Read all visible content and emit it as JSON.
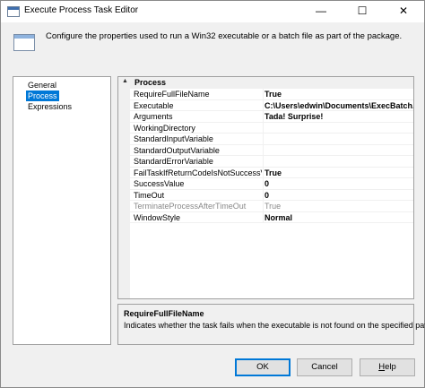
{
  "window": {
    "title": "Execute Process Task Editor",
    "minimize_glyph": "—",
    "maximize_glyph": "☐",
    "close_glyph": "✕"
  },
  "header": {
    "text": "Configure the properties used to run a Win32 executable or a batch file as part of the package."
  },
  "nav": {
    "items": [
      {
        "label": "General",
        "selected": false
      },
      {
        "label": "Process",
        "selected": true
      },
      {
        "label": "Expressions",
        "selected": false
      }
    ]
  },
  "grid": {
    "category": "Process",
    "toggle_glyph": "▲",
    "rows": [
      {
        "name": "RequireFullFileName",
        "value": "True"
      },
      {
        "name": "Executable",
        "value": "C:\\Users\\edwin\\Documents\\ExecBatch.bat"
      },
      {
        "name": "Arguments",
        "value": "Tada! Surprise!"
      },
      {
        "name": "WorkingDirectory",
        "value": ""
      },
      {
        "name": "StandardInputVariable",
        "value": ""
      },
      {
        "name": "StandardOutputVariable",
        "value": ""
      },
      {
        "name": "StandardErrorVariable",
        "value": ""
      },
      {
        "name": "FailTaskIfReturnCodeIsNotSuccessValue",
        "value": "True"
      },
      {
        "name": "SuccessValue",
        "value": "0"
      },
      {
        "name": "TimeOut",
        "value": "0"
      },
      {
        "name": "TerminateProcessAfterTimeOut",
        "value": "True"
      },
      {
        "name": "WindowStyle",
        "value": "Normal"
      }
    ]
  },
  "description": {
    "title": "RequireFullFileName",
    "text": "Indicates whether the task fails when the executable is not found on the specified path."
  },
  "buttons": {
    "ok": "OK",
    "cancel": "Cancel",
    "help_first": "H",
    "help_rest": "elp"
  }
}
